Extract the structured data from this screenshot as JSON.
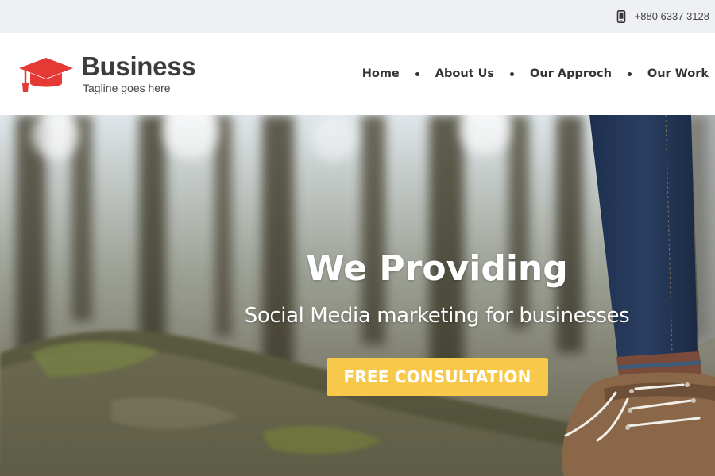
{
  "topbar": {
    "phone_icon": "mobile-phone-icon",
    "phone": "+880 6337 3128"
  },
  "header": {
    "logo_icon": "graduation-cap-icon",
    "brand": "Business",
    "tagline": "Tagline goes here",
    "accent_color": "#e53935"
  },
  "nav": {
    "items": [
      {
        "label": "Home"
      },
      {
        "label": "About Us"
      },
      {
        "label": "Our Approch"
      },
      {
        "label": "Our Work"
      }
    ]
  },
  "hero": {
    "title": "We Providing",
    "subtitle": "Social Media marketing for businesses",
    "cta_label": "FREE CONSULTATION",
    "cta_color": "#f7c84a"
  }
}
